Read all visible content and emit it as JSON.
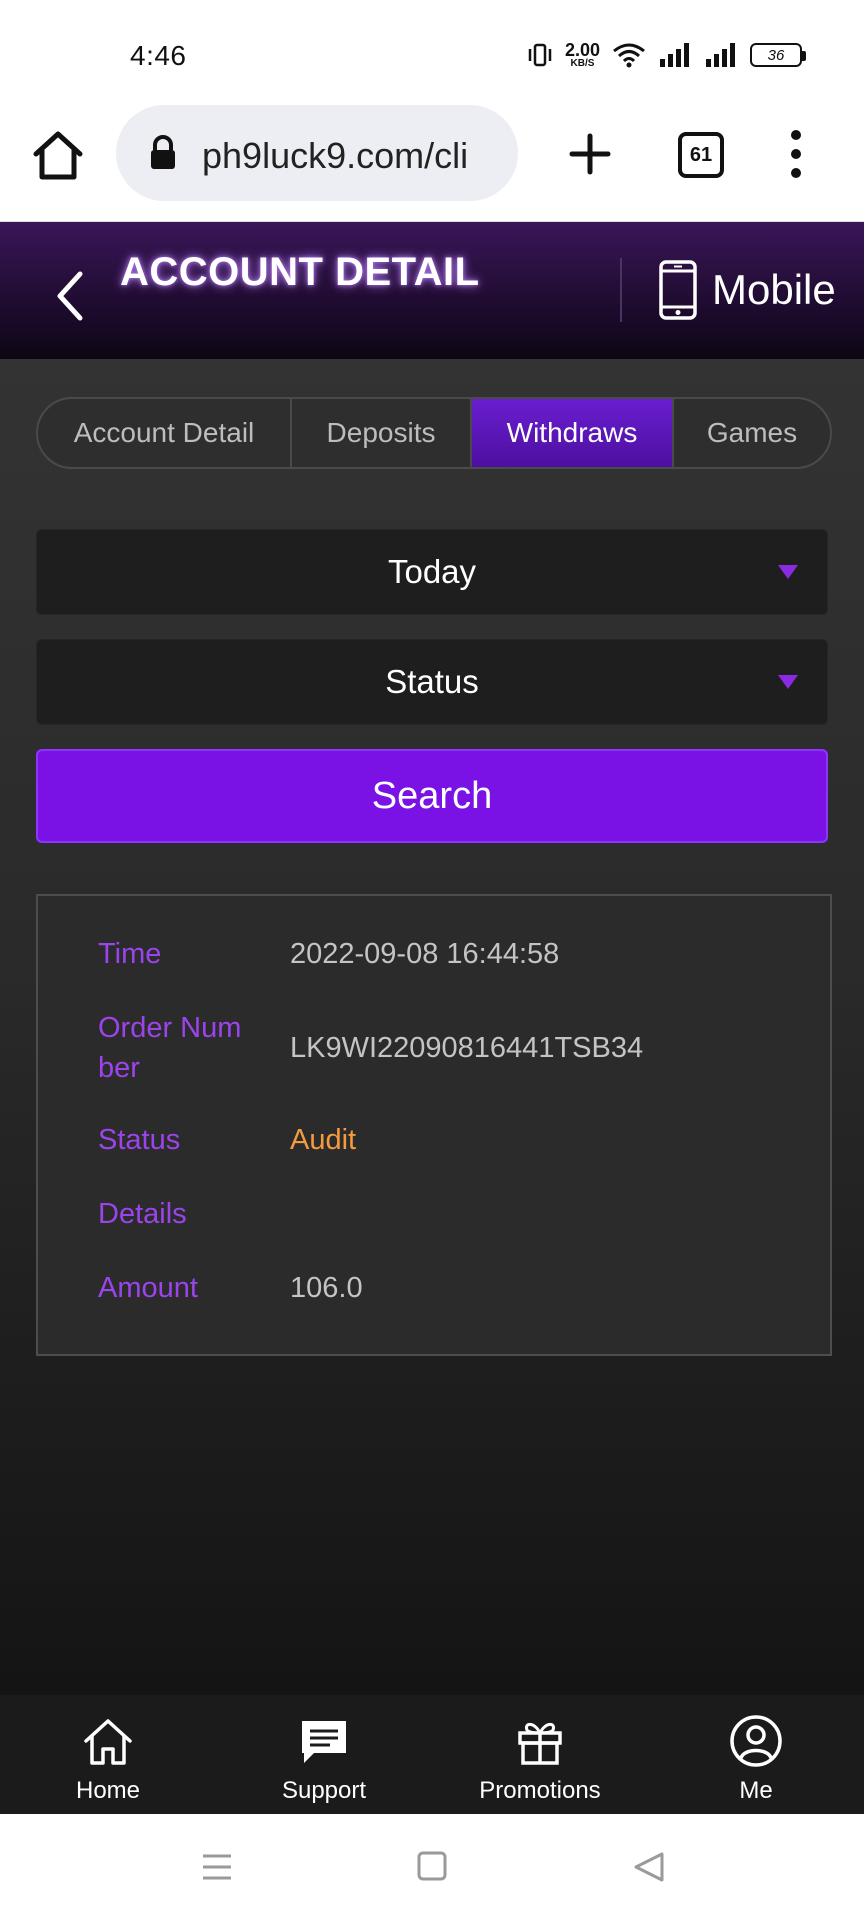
{
  "status_bar": {
    "time": "4:46",
    "net_speed_value": "2.00",
    "net_speed_unit": "KB/S",
    "battery_level": "36"
  },
  "browser": {
    "url": "ph9luck9.com/cli",
    "tab_count": "61"
  },
  "header": {
    "title": "ACCOUNT DETAIL",
    "mobile_label": "Mobile"
  },
  "tabs": [
    {
      "label": "Account Detail",
      "active": false
    },
    {
      "label": "Deposits",
      "active": false
    },
    {
      "label": "Withdraws",
      "active": true
    },
    {
      "label": "Games",
      "active": false
    }
  ],
  "filters": {
    "date_selected": "Today",
    "status_selected": "Status",
    "search_label": "Search"
  },
  "record": {
    "time_label": "Time",
    "time_value": "2022-09-08 16:44:58",
    "order_label_line1": "Order Num",
    "order_label_line2": "ber",
    "order_value": "LK9WI22090816441TSB34",
    "status_label": "Status",
    "status_value": "Audit",
    "details_label": "Details",
    "details_value": "",
    "amount_label": "Amount",
    "amount_value": "106.0"
  },
  "bottom_nav": [
    {
      "label": "Home",
      "icon": "home-icon"
    },
    {
      "label": "Support",
      "icon": "chat-icon"
    },
    {
      "label": "Promotions",
      "icon": "gift-icon"
    },
    {
      "label": "Me",
      "icon": "user-icon"
    }
  ],
  "colors": {
    "accent_purple": "#7a12e6",
    "label_purple": "#9b44ec",
    "status_orange": "#f59a3d"
  }
}
